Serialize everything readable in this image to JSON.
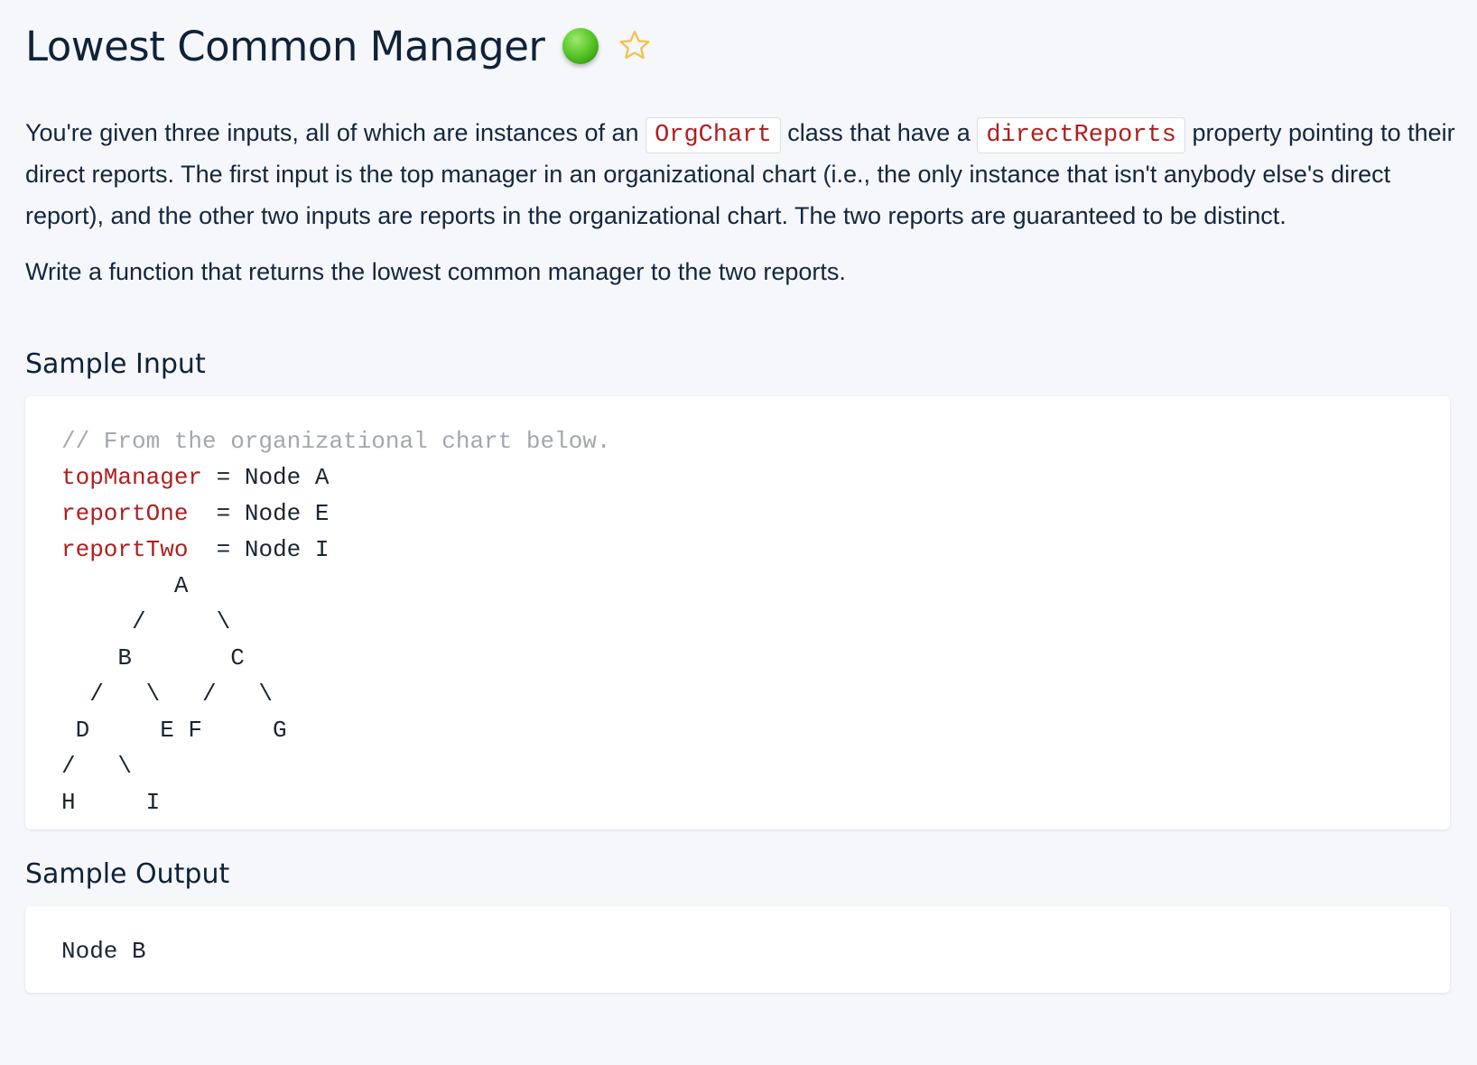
{
  "header": {
    "title": "Lowest Common Manager",
    "status_color": "#5cc92c",
    "status_icon": "green-circle-icon",
    "favorite_icon": "star-outline-icon",
    "favorite_color": "#f2c14e"
  },
  "description": {
    "p1_part1": "You're given three inputs, all of which are instances of an ",
    "p1_code1": "OrgChart",
    "p1_part2": " class that have a ",
    "p1_code2": "directReports",
    "p1_part3": " property pointing to their direct reports. The first input is the top manager in an organizational chart (i.e., the only instance that isn't anybody else's direct report), and the other two inputs are reports in the organizational chart. The two reports are guaranteed to be distinct.",
    "p2": "Write a function that returns the lowest common manager to the two reports."
  },
  "sample_input": {
    "heading": "Sample Input",
    "comment": "// From the organizational chart below.",
    "assignments": [
      {
        "name": "topManager",
        "op": " = ",
        "value": "Node A"
      },
      {
        "name": "reportOne",
        "op": "  = ",
        "value": "Node E"
      },
      {
        "name": "reportTwo",
        "op": "  = ",
        "value": "Node I"
      }
    ],
    "tree_lines": [
      "        A",
      "     /     \\",
      "    B       C",
      "  /   \\   /   \\",
      " D     E F     G",
      "/   \\",
      "H     I"
    ]
  },
  "sample_output": {
    "heading": "Sample Output",
    "value": "Node B"
  }
}
